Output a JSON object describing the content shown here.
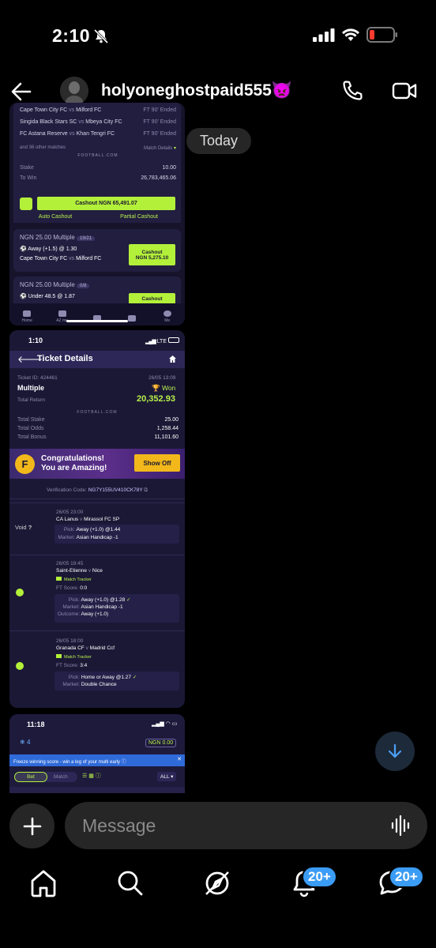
{
  "status": {
    "time": "2:10"
  },
  "header": {
    "username": "holyoneghostpaid555",
    "emoji": "👿"
  },
  "divider": {
    "today": "Today"
  },
  "shot1": {
    "matches": [
      {
        "home": "Cape Town City FC",
        "away": "Milford FC",
        "status": "FT 90' Ended"
      },
      {
        "home": "Singida Black Stars SC",
        "away": "Mbeya City FC",
        "status": "FT 90' Ended"
      },
      {
        "home": "FC Astana Reserve",
        "away": "Khan Tengri FC",
        "status": "FT 90' Ended"
      }
    ],
    "vs": "vs",
    "other_matches": "and 36 other matches",
    "match_details": "Match Details",
    "brand": "FOOTBALL.COM",
    "stake_label": "Stake",
    "stake_value": "10.00",
    "towin_label": "To Win",
    "towin_value": "26,783,465.06",
    "cashout_btn": "Cashout NGN 65,491.07",
    "auto_cashout": "Auto Cashout",
    "partial_cashout": "Partial Cashout",
    "bet2_title": "NGN 25.00  Multiple",
    "bet2_count": "19/21",
    "bet2_pick": "Away (+1.5) @ 1.30",
    "bet2_match_home": "Cape Town City FC",
    "bet2_match_away": "Milford FC",
    "bet2_cashout_label": "Cashout",
    "bet2_cashout_value": "NGN 5,275.10",
    "bet3_title": "NGN 25.00  Multiple",
    "bet3_count": "0/8",
    "bet3_pick": "Under 48.5 @ 1.87",
    "bet3_cashout": "Cashout",
    "tabs": [
      "Home",
      "AZ me",
      "",
      "",
      "Me"
    ]
  },
  "shot2": {
    "time": "1:10",
    "network": "LTE",
    "title": "Ticket Details",
    "ticket_id": "Ticket ID: 424461",
    "date": "26/05 13:09",
    "type": "Multiple",
    "status": "Won",
    "total_return_label": "Total Return",
    "total_return_value": "20,352.93",
    "brand": "FOOTBALL.COM",
    "stats": [
      {
        "label": "Total Stake",
        "value": "25.00"
      },
      {
        "label": "Total Odds",
        "value": "1,258.44"
      },
      {
        "label": "Total Bonus",
        "value": "11,101.60"
      }
    ],
    "banner_line1": "Congratulations!",
    "banner_line2": "You are Amazing!",
    "show_off": "Show Off",
    "verification": "Verification Code:",
    "verification_code": "NG7Y155UV410CK78Y",
    "legs": [
      {
        "state": "Void",
        "datetime": "26/05 23:00",
        "home": "CA Lanus",
        "away": "Mirassol FC SP",
        "tracker": "",
        "score_label": "",
        "score": "",
        "pick_label": "Pick:",
        "pick": "Away (+1.0) @1.44",
        "market_label": "Market:",
        "market": "Asian Handicap -1",
        "outcome_label": "",
        "outcome": ""
      },
      {
        "state": "won",
        "datetime": "26/05 19:45",
        "home": "Saint-Etienne",
        "away": "Nice",
        "tracker": "Match Tracker",
        "score_label": "FT Score:",
        "score": "0:0",
        "pick_label": "Pick:",
        "pick": "Away (+1.0) @1.28",
        "market_label": "Market:",
        "market": "Asian Handicap -1",
        "outcome_label": "Outcome:",
        "outcome": "Away (+1.0)"
      },
      {
        "state": "won",
        "datetime": "26/05 18:00",
        "home": "Granada CF",
        "away": "Madrid Ccf",
        "tracker": "Match Tracker",
        "score_label": "FT Score:",
        "score": "3:4",
        "pick_label": "Pick:",
        "pick": "Home or Away @1.27",
        "market_label": "Market:",
        "market": "Double Chance",
        "outcome_label": "",
        "outcome": ""
      }
    ],
    "vs": "v"
  },
  "shot3": {
    "time": "11:18",
    "count": "4",
    "balance": "NGN 0.00",
    "freeze_text": "Freeze winning score - win a leg of your multi early",
    "tab_bet": "Bet",
    "tab_match": "Match",
    "filter_all": "ALL"
  },
  "composer": {
    "placeholder": "Message"
  },
  "nav": {
    "notif_badge": "20+",
    "msg_badge": "20+"
  },
  "colors": {
    "accent_green": "#b3f03a",
    "app_bg": "#1b1836",
    "badge_blue": "#3b9cf5"
  }
}
